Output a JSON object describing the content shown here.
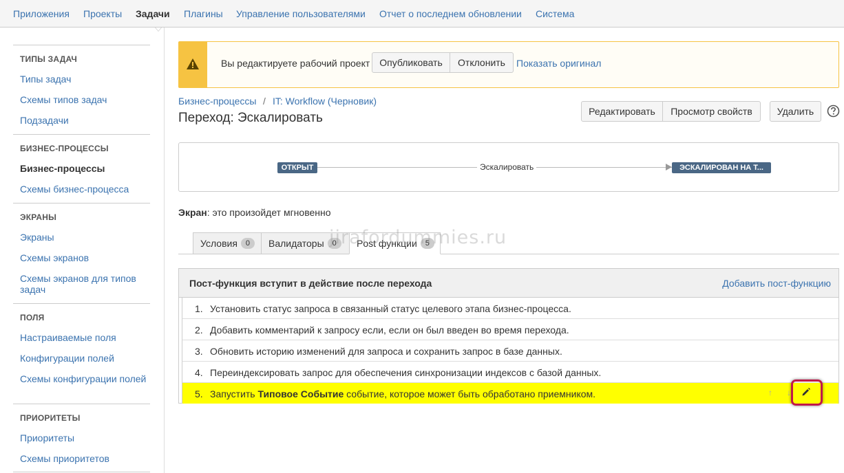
{
  "topnav": {
    "items": [
      "Приложения",
      "Проекты",
      "Задачи",
      "Плагины",
      "Управление пользователями",
      "Отчет о последнем обновлении",
      "Система"
    ],
    "active_index": 2
  },
  "sidebar": {
    "sections": [
      {
        "heading": "ТИПЫ ЗАДАЧ",
        "items": [
          "Типы задач",
          "Схемы типов задач",
          "Подзадачи"
        ]
      },
      {
        "heading": "БИЗНЕС-ПРОЦЕССЫ",
        "items": [
          "Бизнес-процессы",
          "Схемы бизнес-процесса"
        ]
      },
      {
        "heading": "ЭКРАНЫ",
        "items": [
          "Экраны",
          "Схемы экранов",
          "Схемы экранов для типов задач"
        ]
      },
      {
        "heading": "ПОЛЯ",
        "items": [
          "Настраиваемые поля",
          "Конфигурации полей",
          "Схемы конфигурации полей"
        ]
      },
      {
        "heading": "ПРИОРИТЕТЫ",
        "items": [
          "Приоритеты",
          "Схемы приоритетов"
        ]
      }
    ],
    "active_item": "Бизнес-процессы"
  },
  "banner": {
    "message": "Вы редактируете рабочий проект",
    "publish_label": "Опубликовать",
    "discard_label": "Отклонить",
    "show_original_label": "Показать оригинал"
  },
  "breadcrumb": {
    "items": [
      "Бизнес-процессы",
      "IT: Workflow (Черновик)"
    ],
    "separator": "/"
  },
  "page_title": "Переход: Эскалировать",
  "toolbar": {
    "edit_label": "Редактировать",
    "view_props_label": "Просмотр свойств",
    "delete_label": "Удалить",
    "help_icon": "question-circle-icon"
  },
  "workflow": {
    "from_status": "ОТКРЫТ",
    "transition": "Эскалировать",
    "to_status": "ЭСКАЛИРОВАН НА Т...",
    "status_color": "#4a6785"
  },
  "screen_info": {
    "label": "Экран",
    "text": ": это произойдет мгновенно"
  },
  "tabs": [
    {
      "label": "Условия",
      "count": "0"
    },
    {
      "label": "Валидаторы",
      "count": "0"
    },
    {
      "label": "Post функции",
      "count": "5"
    }
  ],
  "active_tab": "Post функции",
  "watermark": "jirafordummies.ru",
  "post_functions": {
    "heading": "Пост-функция вступит в действие после перехода",
    "add_label": "Добавить пост-функцию",
    "rows": [
      {
        "num": "1.",
        "text": "Установить статус запроса в связанный статус целевого этапа бизнес-процесса."
      },
      {
        "num": "2.",
        "text": "Добавить комментарий к запросу если, если он был введен во время перехода."
      },
      {
        "num": "3.",
        "text": "Обновить историю изменений для запроса и сохранить запрос в базе данных."
      },
      {
        "num": "4.",
        "text": "Переиндексировать запрос для обеспечения синхронизации индексов с базой данных."
      }
    ],
    "highlighted_row": {
      "num": "5.",
      "prefix": "Запустить ",
      "bold": "Типовое Событие",
      "suffix": " событие, которое может быть обработано приемником.",
      "highlight_color": "#ffff00"
    }
  },
  "colors": {
    "link": "#3b73af",
    "warning": "#f6c342",
    "highlight_ring": "#c0184a"
  }
}
